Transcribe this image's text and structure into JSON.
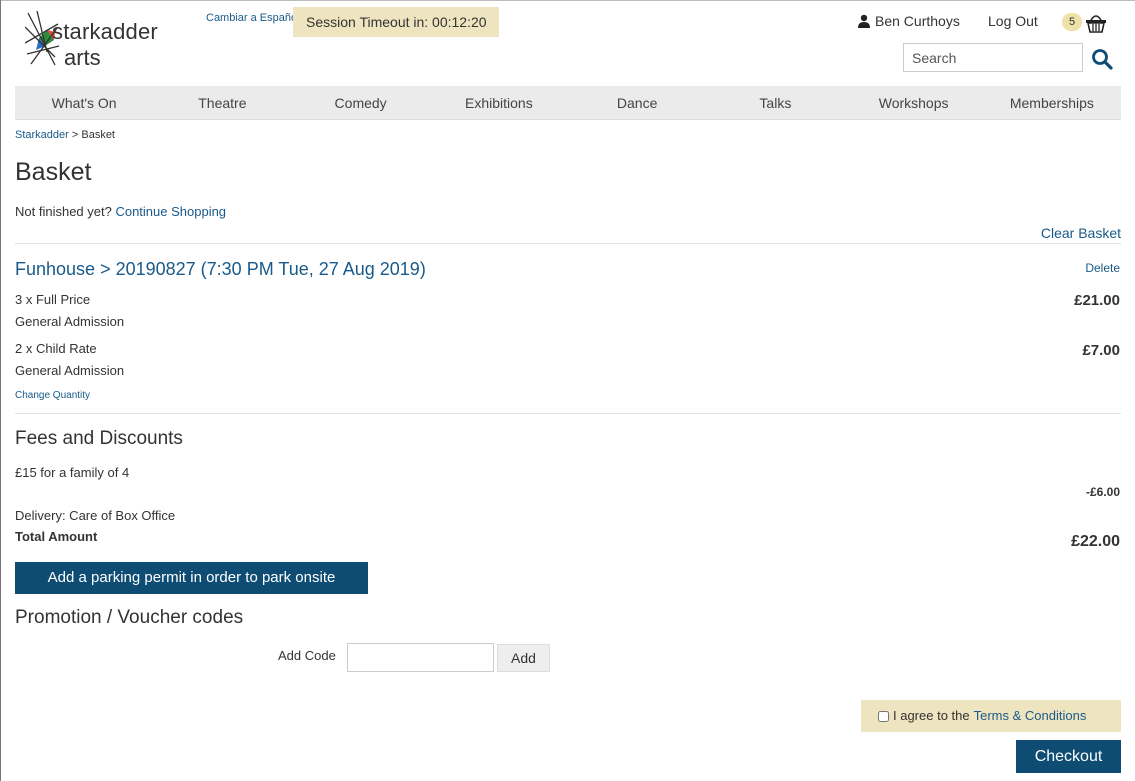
{
  "header": {
    "logo_line1": "starkadder",
    "logo_line2": "arts",
    "language_link": "Cambiar a Español",
    "session_timeout": "Session Timeout in: 00:12:20",
    "user_name": "Ben Curthoys",
    "logout_label": "Log Out",
    "cart_count": "5",
    "search_placeholder": "Search"
  },
  "nav": {
    "items": [
      "What's On",
      "Theatre",
      "Comedy",
      "Exhibitions",
      "Dance",
      "Talks",
      "Workshops",
      "Memberships"
    ]
  },
  "breadcrumb": {
    "home": "Starkadder",
    "separator": " > ",
    "current": "Basket"
  },
  "page": {
    "title": "Basket",
    "not_finished_text": "Not finished yet? ",
    "continue_shopping": "Continue Shopping",
    "clear_basket": "Clear Basket"
  },
  "event": {
    "name": "Funhouse",
    "separator": " > ",
    "performance": "20190827 (7:30 PM Tue, 27 Aug 2019)",
    "delete_label": "Delete",
    "lines": [
      {
        "qty_label": "3 x Full Price",
        "area": "General Admission",
        "price": "£21.00"
      },
      {
        "qty_label": "2 x Child Rate",
        "area": "General Admission",
        "price": "£7.00"
      }
    ],
    "change_quantity": "Change Quantity"
  },
  "fees": {
    "title": "Fees and Discounts",
    "discount_label": "£15 for a family of 4",
    "discount_value": "-£6.00",
    "delivery": "Delivery: Care of Box Office",
    "total_label": "Total Amount",
    "total_value": "£22.00"
  },
  "parking_button": "Add a parking permit in order to park onsite",
  "promo": {
    "title": "Promotion / Voucher codes",
    "code_label": "Add Code",
    "add_button": "Add"
  },
  "terms": {
    "prefix": "I agree to the ",
    "link": "Terms & Conditions"
  },
  "checkout_label": "Checkout",
  "colors": {
    "primary": "#0f4c74",
    "link": "#1a5a8a",
    "highlight": "#eee4bf"
  }
}
